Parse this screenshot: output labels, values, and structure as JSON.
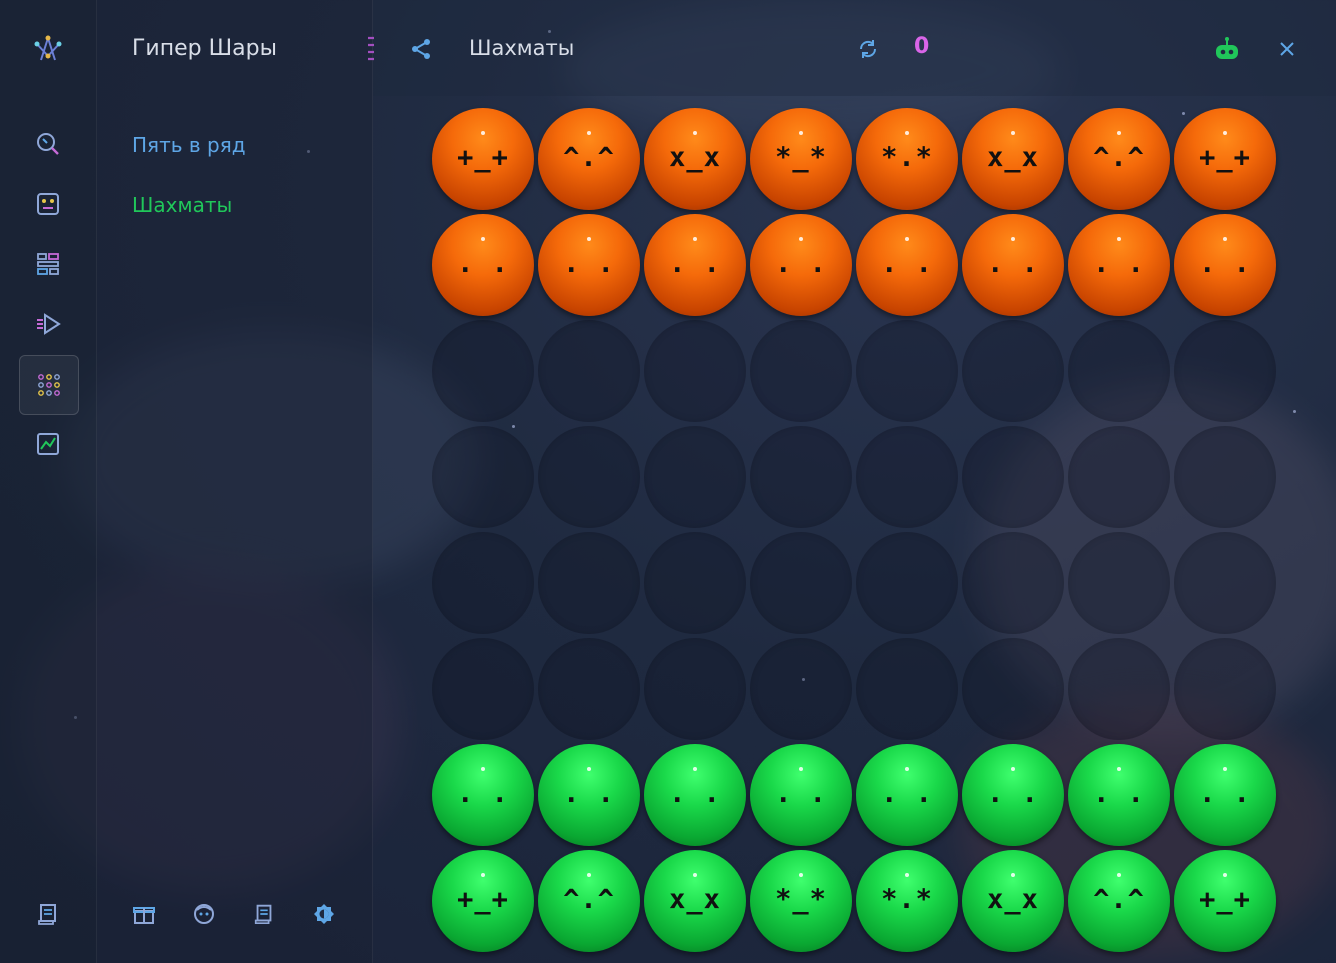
{
  "app": {
    "title": "Гипер Шары"
  },
  "sidebar": {
    "menu": [
      {
        "label": "Пять в ряд",
        "color": "#5ea6e6"
      },
      {
        "label": "Шахматы",
        "color": "#20c75a"
      }
    ]
  },
  "header": {
    "title": "Шахматы",
    "score": "0"
  },
  "rail": {
    "icons": [
      "search-icon",
      "robot-face-icon",
      "blocks-icon",
      "play-list-icon",
      "dots-grid-icon",
      "chart-icon"
    ],
    "active_index": 4,
    "bottom_icon": "scroll-icon"
  },
  "footer_icons": [
    "gift-icon",
    "face-icon",
    "scroll-icon",
    "brightness-icon"
  ],
  "board": {
    "rows": 8,
    "cols": 8,
    "cells": [
      [
        "orange:+_+",
        "orange:^.^",
        "orange:x_x",
        "orange:*_*",
        "orange:*.*",
        "orange:x_x",
        "orange:^.^",
        "orange:+_+"
      ],
      [
        "orange:. .",
        "orange:. .",
        "orange:. .",
        "orange:. .",
        "orange:. .",
        "orange:. .",
        "orange:. .",
        "orange:. ."
      ],
      [
        "",
        "",
        "",
        "",
        "",
        "",
        "",
        ""
      ],
      [
        "",
        "",
        "",
        "",
        "",
        "",
        "",
        ""
      ],
      [
        "",
        "",
        "",
        "",
        "",
        "",
        "",
        ""
      ],
      [
        "",
        "",
        "",
        "",
        "",
        "",
        "",
        ""
      ],
      [
        "green:. .",
        "green:. .",
        "green:. .",
        "green:. .",
        "green:. .",
        "green:. .",
        "green:. .",
        "green:. ."
      ],
      [
        "green:+_+",
        "green:^.^",
        "green:x_x",
        "green:*_*",
        "green:*.*",
        "green:x_x",
        "green:^.^",
        "green:+_+"
      ]
    ]
  }
}
